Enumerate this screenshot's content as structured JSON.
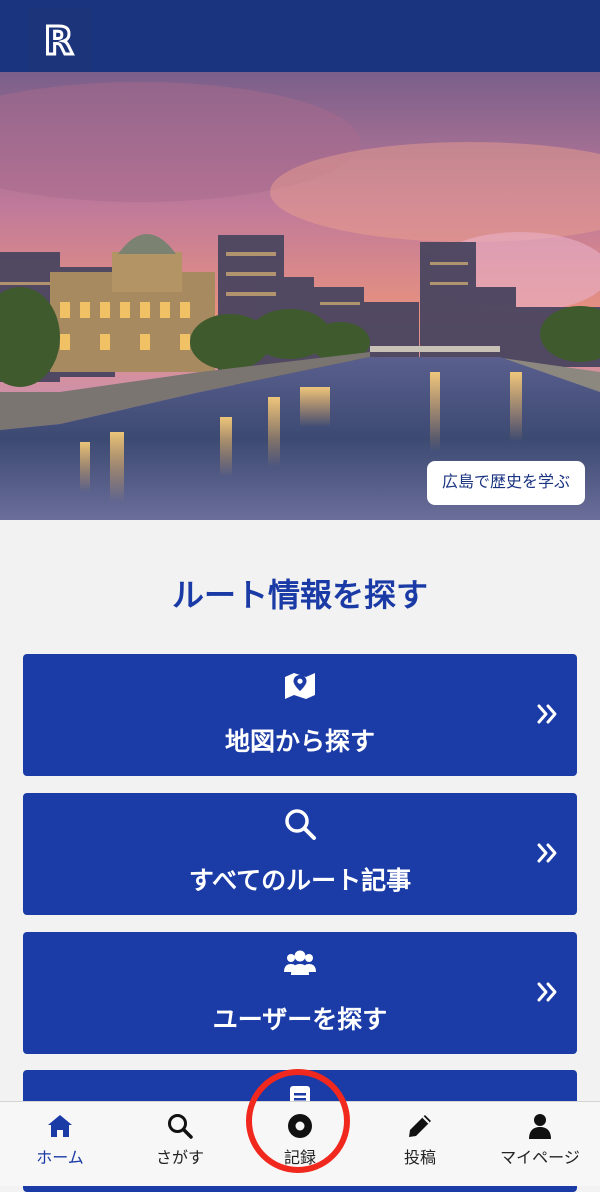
{
  "header": {
    "logo_letter": "R"
  },
  "hero": {
    "tag_label": "広島で歴史を学ぶ"
  },
  "section": {
    "title": "ルート情報を探す"
  },
  "cards": [
    {
      "label": "地図から探す",
      "icon": "map-icon"
    },
    {
      "label": "すべてのルート記事",
      "icon": "search-icon"
    },
    {
      "label": "ユーザーを探す",
      "icon": "users-icon"
    }
  ],
  "bottom_nav": {
    "items": [
      {
        "label": "ホーム",
        "icon": "home-icon",
        "active": true
      },
      {
        "label": "さがす",
        "icon": "search-icon"
      },
      {
        "label": "記録",
        "icon": "record-icon"
      },
      {
        "label": "投稿",
        "icon": "pencil-icon"
      },
      {
        "label": "マイページ",
        "icon": "user-icon"
      }
    ]
  },
  "colors": {
    "brand": "#1a3480",
    "card": "#1b3ba7",
    "title": "#1a3aa6",
    "highlight": "#f0281e"
  }
}
